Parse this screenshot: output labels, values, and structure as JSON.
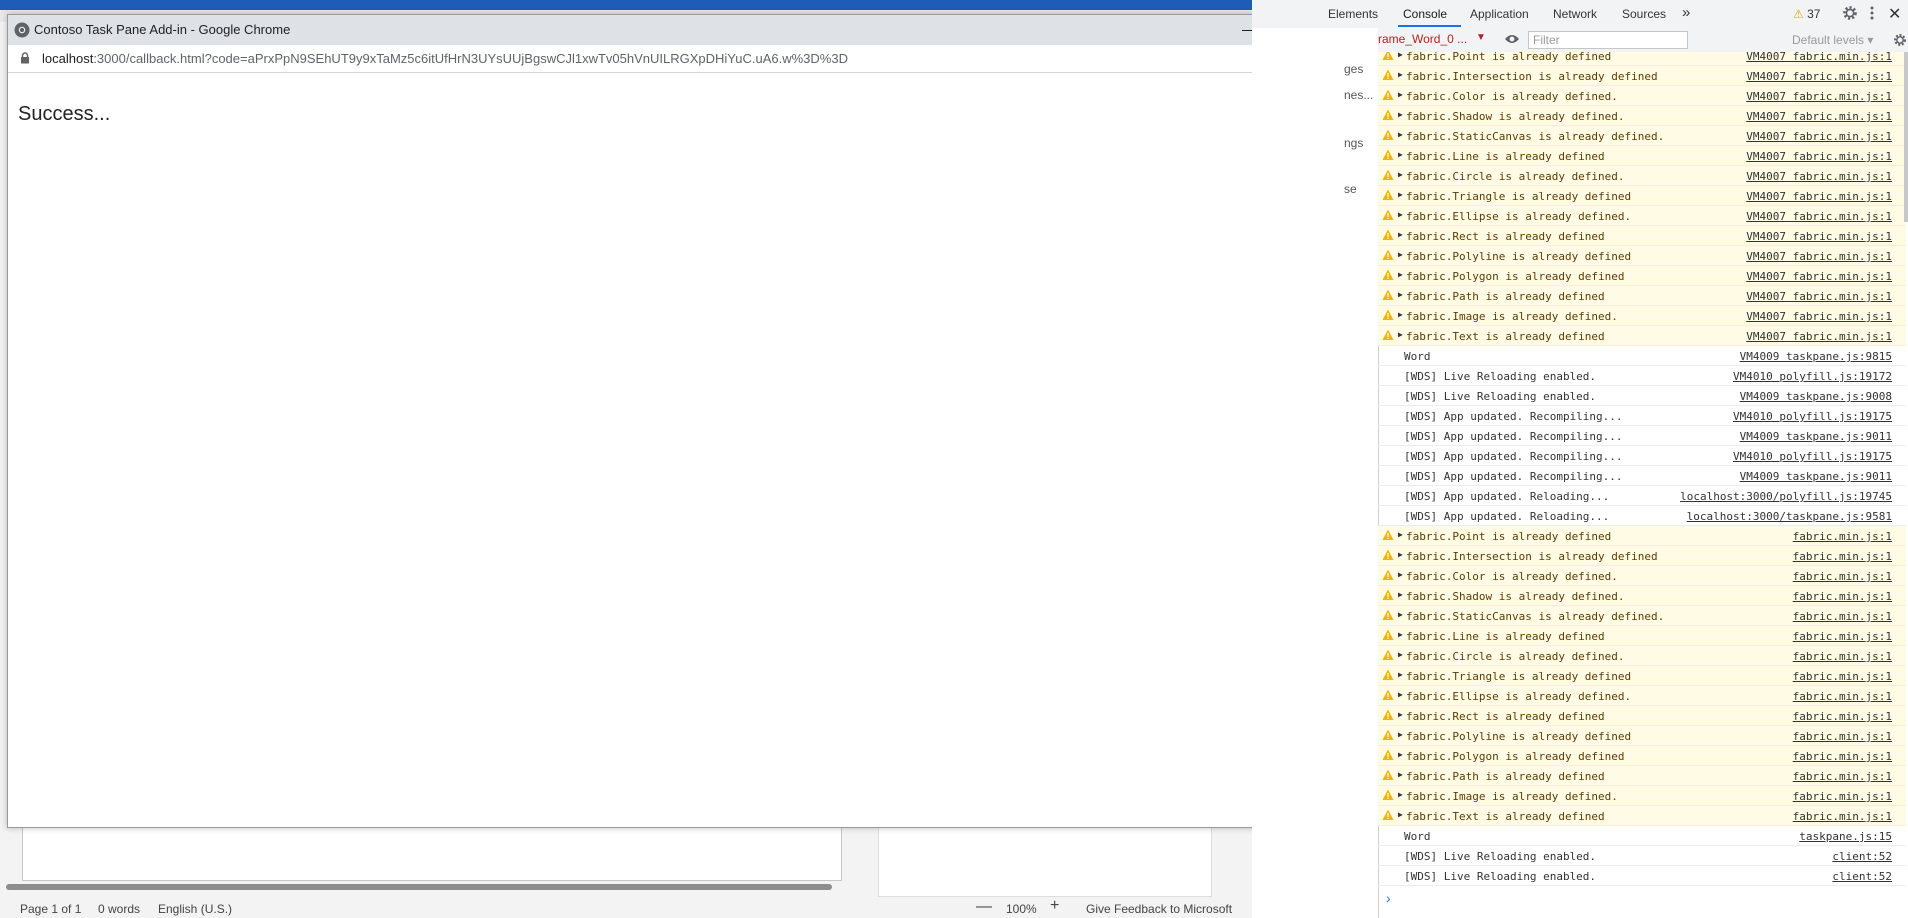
{
  "word": {
    "status": {
      "page": "Page 1 of 1",
      "words": "0 words",
      "language": "English (U.S.)",
      "zoom_out": "—",
      "zoom": "100%",
      "zoom_in": "+",
      "feedback": "Give Feedback to Microsoft"
    }
  },
  "popup": {
    "title": "Contoso Task Pane Add-in - Google Chrome",
    "url_host": "localhost",
    "url_path": ":3000/callback.html?code=aPrxPpN9SEhUT9y9xTaMz5c6itUfHrN3UYsUUjBgswCJl1xwTv05hVnUILRGXpDHiYuC.uA6.w%3D%3D",
    "body_text": "Success..."
  },
  "devtools": {
    "tabs": {
      "elements": "Elements",
      "console": "Console",
      "application": "Application",
      "network": "Network",
      "sources": "Sources",
      "more": "»"
    },
    "warning_count": "37",
    "left_strip": [
      "ges",
      "nes...",
      "ngs",
      "se"
    ],
    "toolbar": {
      "context": "rame_Word_0 ...",
      "filter_placeholder": "Filter",
      "levels": "Default levels ▾"
    },
    "colors": {
      "warning_bg": "#fffbe5",
      "warning_icon": "#f2b400",
      "accent": "#1a73e8"
    },
    "logs": [
      {
        "type": "warn",
        "msg": "fabric.Point is already defined",
        "src": "VM4007 fabric.min.js:1"
      },
      {
        "type": "warn",
        "msg": "fabric.Intersection is already defined",
        "src": "VM4007 fabric.min.js:1"
      },
      {
        "type": "warn",
        "msg": "fabric.Color is already defined.",
        "src": "VM4007 fabric.min.js:1"
      },
      {
        "type": "warn",
        "msg": "fabric.Shadow is already defined.",
        "src": "VM4007 fabric.min.js:1"
      },
      {
        "type": "warn",
        "msg": "fabric.StaticCanvas is already defined.",
        "src": "VM4007 fabric.min.js:1"
      },
      {
        "type": "warn",
        "msg": "fabric.Line is already defined",
        "src": "VM4007 fabric.min.js:1"
      },
      {
        "type": "warn",
        "msg": "fabric.Circle is already defined.",
        "src": "VM4007 fabric.min.js:1"
      },
      {
        "type": "warn",
        "msg": "fabric.Triangle is already defined",
        "src": "VM4007 fabric.min.js:1"
      },
      {
        "type": "warn",
        "msg": "fabric.Ellipse is already defined.",
        "src": "VM4007 fabric.min.js:1"
      },
      {
        "type": "warn",
        "msg": "fabric.Rect is already defined",
        "src": "VM4007 fabric.min.js:1"
      },
      {
        "type": "warn",
        "msg": "fabric.Polyline is already defined",
        "src": "VM4007 fabric.min.js:1"
      },
      {
        "type": "warn",
        "msg": "fabric.Polygon is already defined",
        "src": "VM4007 fabric.min.js:1"
      },
      {
        "type": "warn",
        "msg": "fabric.Path is already defined",
        "src": "VM4007 fabric.min.js:1"
      },
      {
        "type": "warn",
        "msg": "fabric.Image is already defined.",
        "src": "VM4007 fabric.min.js:1"
      },
      {
        "type": "warn",
        "msg": "fabric.Text is already defined",
        "src": "VM4007 fabric.min.js:1"
      },
      {
        "type": "info",
        "msg": "Word",
        "src": "VM4009 taskpane.js:9815"
      },
      {
        "type": "info",
        "msg": "[WDS] Live Reloading enabled.",
        "src": "VM4010 polyfill.js:19172"
      },
      {
        "type": "info",
        "msg": "[WDS] Live Reloading enabled.",
        "src": "VM4009 taskpane.js:9008"
      },
      {
        "type": "info",
        "msg": "[WDS] App updated. Recompiling...",
        "src": "VM4010 polyfill.js:19175"
      },
      {
        "type": "info",
        "msg": "[WDS] App updated. Recompiling...",
        "src": "VM4009 taskpane.js:9011"
      },
      {
        "type": "info",
        "msg": "[WDS] App updated. Recompiling...",
        "src": "VM4010 polyfill.js:19175"
      },
      {
        "type": "info",
        "msg": "[WDS] App updated. Recompiling...",
        "src": "VM4009 taskpane.js:9011"
      },
      {
        "type": "info",
        "msg": "[WDS] App updated. Reloading...",
        "src": "localhost:3000/polyfill.js:19745"
      },
      {
        "type": "info",
        "msg": "[WDS] App updated. Reloading...",
        "src": "localhost:3000/taskpane.js:9581"
      },
      {
        "type": "warn",
        "msg": "fabric.Point is already defined",
        "src": "fabric.min.js:1"
      },
      {
        "type": "warn",
        "msg": "fabric.Intersection is already defined",
        "src": "fabric.min.js:1"
      },
      {
        "type": "warn",
        "msg": "fabric.Color is already defined.",
        "src": "fabric.min.js:1"
      },
      {
        "type": "warn",
        "msg": "fabric.Shadow is already defined.",
        "src": "fabric.min.js:1"
      },
      {
        "type": "warn",
        "msg": "fabric.StaticCanvas is already defined.",
        "src": "fabric.min.js:1"
      },
      {
        "type": "warn",
        "msg": "fabric.Line is already defined",
        "src": "fabric.min.js:1"
      },
      {
        "type": "warn",
        "msg": "fabric.Circle is already defined.",
        "src": "fabric.min.js:1"
      },
      {
        "type": "warn",
        "msg": "fabric.Triangle is already defined",
        "src": "fabric.min.js:1"
      },
      {
        "type": "warn",
        "msg": "fabric.Ellipse is already defined.",
        "src": "fabric.min.js:1"
      },
      {
        "type": "warn",
        "msg": "fabric.Rect is already defined",
        "src": "fabric.min.js:1"
      },
      {
        "type": "warn",
        "msg": "fabric.Polyline is already defined",
        "src": "fabric.min.js:1"
      },
      {
        "type": "warn",
        "msg": "fabric.Polygon is already defined",
        "src": "fabric.min.js:1"
      },
      {
        "type": "warn",
        "msg": "fabric.Path is already defined",
        "src": "fabric.min.js:1"
      },
      {
        "type": "warn",
        "msg": "fabric.Image is already defined.",
        "src": "fabric.min.js:1"
      },
      {
        "type": "warn",
        "msg": "fabric.Text is already defined",
        "src": "fabric.min.js:1"
      },
      {
        "type": "info",
        "msg": "Word",
        "src": "taskpane.js:15"
      },
      {
        "type": "info",
        "msg": "[WDS] Live Reloading enabled.",
        "src": "client:52"
      },
      {
        "type": "info",
        "msg": "[WDS] Live Reloading enabled.",
        "src": "client:52"
      }
    ],
    "prompt_symbol": "›"
  }
}
